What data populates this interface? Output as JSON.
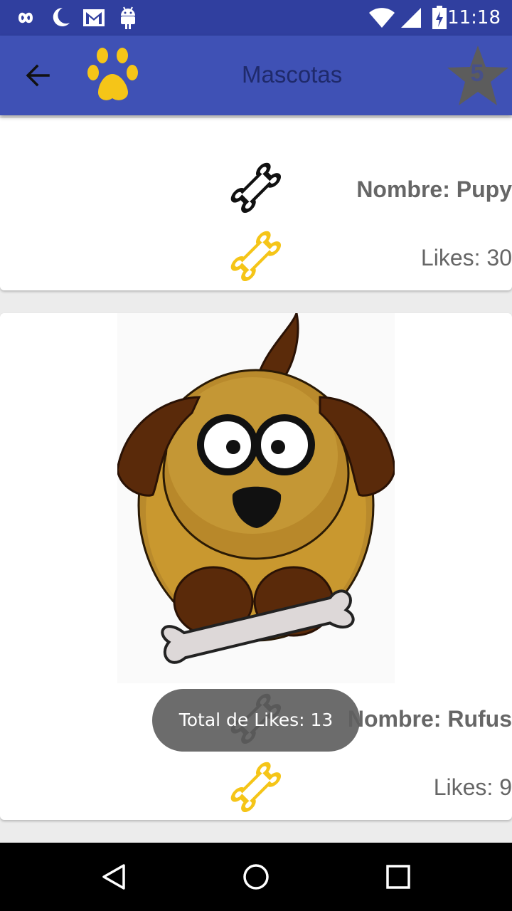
{
  "status_bar": {
    "time": "11:18",
    "icons": [
      "infinity-icon",
      "moon-icon",
      "gmail-icon",
      "android-icon",
      "wifi-icon",
      "signal-icon",
      "battery-icon"
    ]
  },
  "app_bar": {
    "title": "Mascotas",
    "favorites_count": "5",
    "colors": {
      "primary": "#3f51b5",
      "primary_dark": "#303f9f",
      "accent": "#f5c518"
    }
  },
  "pets": [
    {
      "name_label": "Nombre: Pupy",
      "likes_label": "Likes: 30"
    },
    {
      "name_label": "Nombre: Rufus",
      "likes_label": "Likes: 9"
    }
  ],
  "toast": {
    "text": "Total de Likes:  13"
  },
  "nav_bar": {
    "buttons": [
      "back-triangle-icon",
      "home-circle-icon",
      "recents-square-icon"
    ]
  }
}
